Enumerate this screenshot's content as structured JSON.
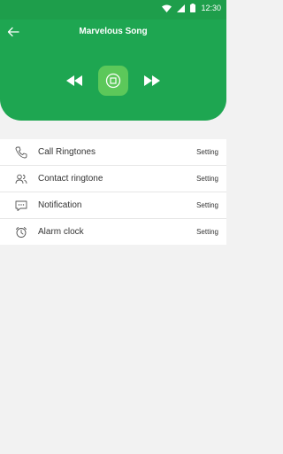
{
  "status_bar": {
    "time": "12:30",
    "icons": [
      "wifi-icon",
      "signal-icon",
      "battery-icon"
    ]
  },
  "header": {
    "title": "Marvelous Song",
    "back_icon": "arrow-left-icon"
  },
  "controls": {
    "icons": [
      "rewind-icon",
      "stop-icon",
      "fast-forward-icon"
    ]
  },
  "list": {
    "items": [
      {
        "label": "Call Ringtones",
        "action": "Setting",
        "icon": "phone-icon"
      },
      {
        "label": "Contact ringtone",
        "action": "Setting",
        "icon": "contacts-icon"
      },
      {
        "label": "Notification",
        "action": "Setting",
        "icon": "message-icon"
      },
      {
        "label": "Alarm clock",
        "action": "Setting",
        "icon": "alarm-clock-icon"
      }
    ]
  },
  "colors": {
    "primary": "#1ea651",
    "status_bar": "#1e9e4b",
    "accent": "#5cc85a",
    "background": "#f2f2f2"
  }
}
